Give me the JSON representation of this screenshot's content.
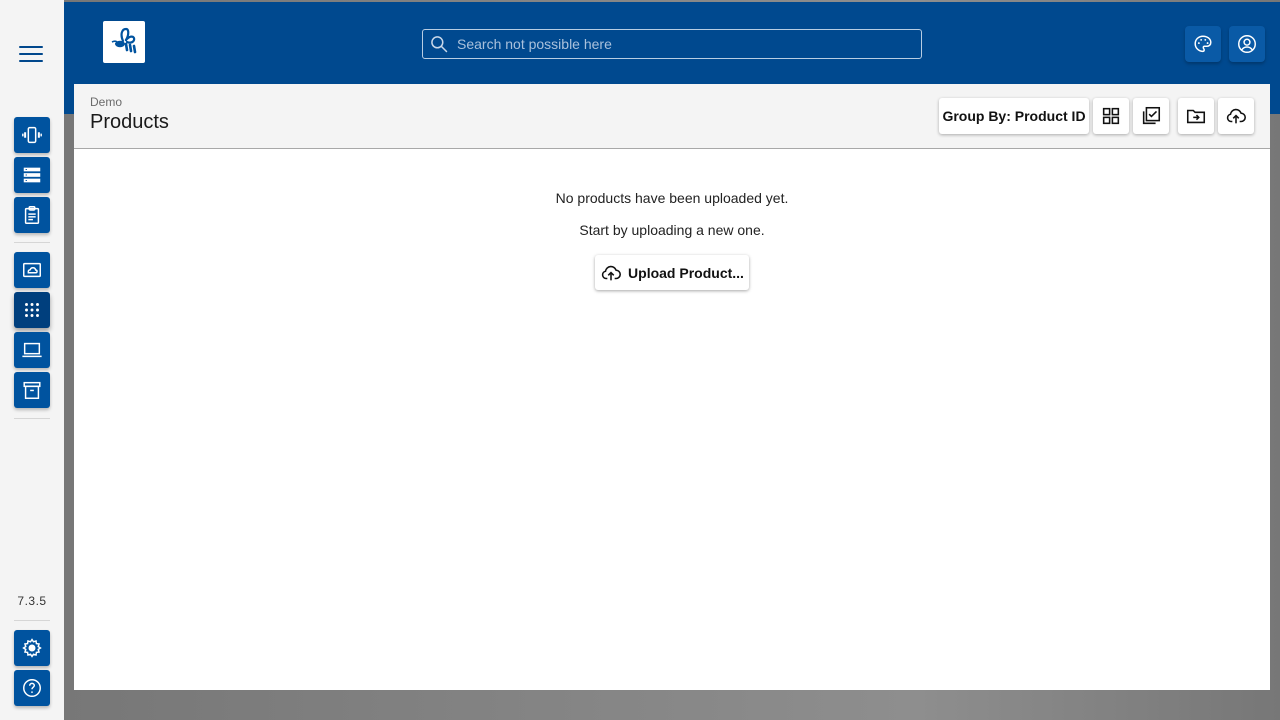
{
  "app": {
    "logo_alt": "bee-logo",
    "version": "7.3.5"
  },
  "search": {
    "placeholder": "Search not possible here",
    "value": ""
  },
  "rail": {
    "top_items": [
      {
        "name": "devices",
        "icon": "vibrate-device-icon"
      },
      {
        "name": "servers",
        "icon": "server-list-icon"
      },
      {
        "name": "reports",
        "icon": "clipboard-icon"
      }
    ],
    "middle_items": [
      {
        "name": "cloud-frame",
        "icon": "cloud-frame-icon"
      },
      {
        "name": "products",
        "icon": "apps-grid-icon",
        "active": true
      },
      {
        "name": "laptop",
        "icon": "laptop-icon"
      },
      {
        "name": "archive",
        "icon": "archive-icon"
      }
    ],
    "bottom_items": [
      {
        "name": "settings",
        "icon": "gear-icon"
      },
      {
        "name": "help",
        "icon": "help-icon"
      }
    ]
  },
  "header": {
    "breadcrumb": "Demo",
    "title": "Products",
    "group_by_label": "Group By: Product ID",
    "toolbar_icons": [
      "grid-view-icon",
      "multi-select-icon",
      "move-to-folder-icon",
      "upload-cloud-icon"
    ]
  },
  "empty_state": {
    "line1": "No products have been uploaded yet.",
    "line2": "Start by uploading a new one.",
    "upload_label": "Upload Product..."
  },
  "colors": {
    "primary": "#00498f",
    "rail_button": "#00539f",
    "rail_button_active": "#003f7d"
  }
}
